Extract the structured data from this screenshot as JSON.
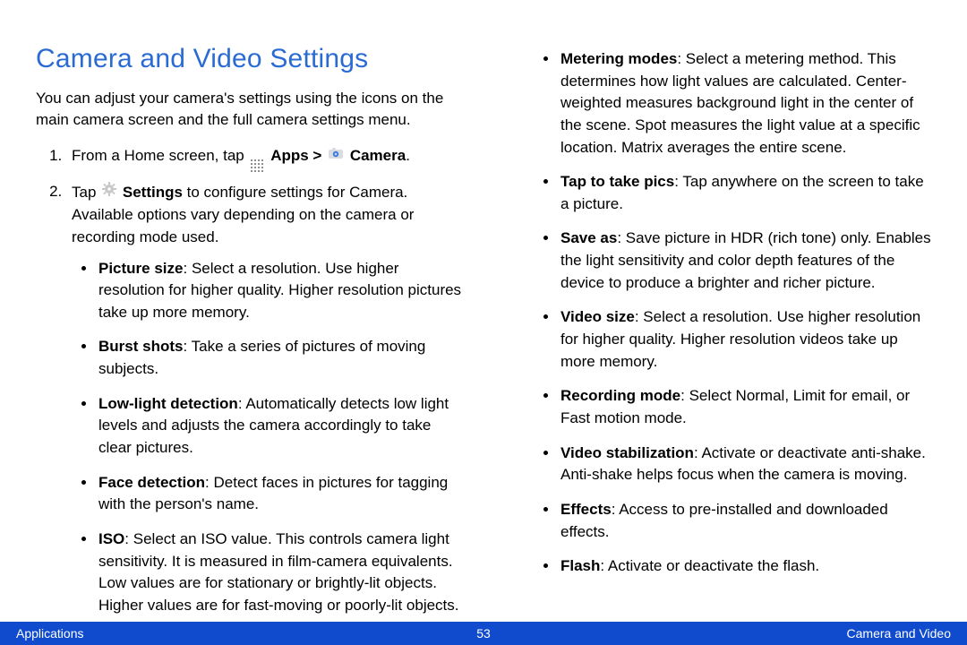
{
  "title": "Camera and Video Settings",
  "intro": "You can adjust your camera's settings using the icons on the main camera screen and the full camera settings menu.",
  "step1": {
    "prefix": "From a Home screen, tap ",
    "apps_label": "Apps > ",
    "camera_label": "Camera",
    "suffix": "."
  },
  "step2": {
    "prefix": "Tap ",
    "settings_label": "Settings",
    "body": "  to configure settings for Camera. Available options vary depending on the camera or recording mode used."
  },
  "left_bullets": [
    {
      "label": "Picture size",
      "text": ": Select a resolution. Use higher resolution for higher quality. Higher resolution pictures take up more memory."
    },
    {
      "label": "Burst shots",
      "text": ": Take a series of pictures of moving subjects."
    },
    {
      "label": "Low-light detection",
      "text": ": Automatically detects low light levels and adjusts the camera accordingly to take clear pictures."
    },
    {
      "label": "Face detection",
      "text": ": Detect faces in pictures for tagging with the person's name."
    },
    {
      "label": "ISO",
      "text": ": Select an ISO value. This controls camera light sensitivity. It is measured in film-camera equivalents. Low values are for stationary or brightly-lit objects. Higher values are for fast-moving or poorly-lit objects."
    }
  ],
  "right_bullets": [
    {
      "label": "Metering modes",
      "text": ": Select a metering method. This determines how light values are calculated. Center-weighted measures background light in the center of the scene. Spot measures the light value at a specific location. Matrix averages the entire scene."
    },
    {
      "label": "Tap to take pics",
      "text": ": Tap anywhere on the screen to take a picture."
    },
    {
      "label": "Save as",
      "text": ": Save picture in HDR (rich tone) only. Enables the light sensitivity and color depth features of the device to produce a brighter and richer picture."
    },
    {
      "label": "Video size",
      "text": ": Select a resolution. Use higher resolution for higher quality. Higher resolution videos take up more memory."
    },
    {
      "label": "Recording mode",
      "text": ": Select Normal, Limit for email, or Fast motion mode."
    },
    {
      "label": "Video stabilization",
      "text": ": Activate or deactivate anti-shake. Anti-shake helps focus when the camera is moving."
    },
    {
      "label": "Effects",
      "text": ": Access to pre-installed and downloaded effects."
    },
    {
      "label": "Flash",
      "text": ": Activate or deactivate the flash."
    }
  ],
  "footer": {
    "left": "Applications",
    "page": "53",
    "right": "Camera and Video"
  }
}
